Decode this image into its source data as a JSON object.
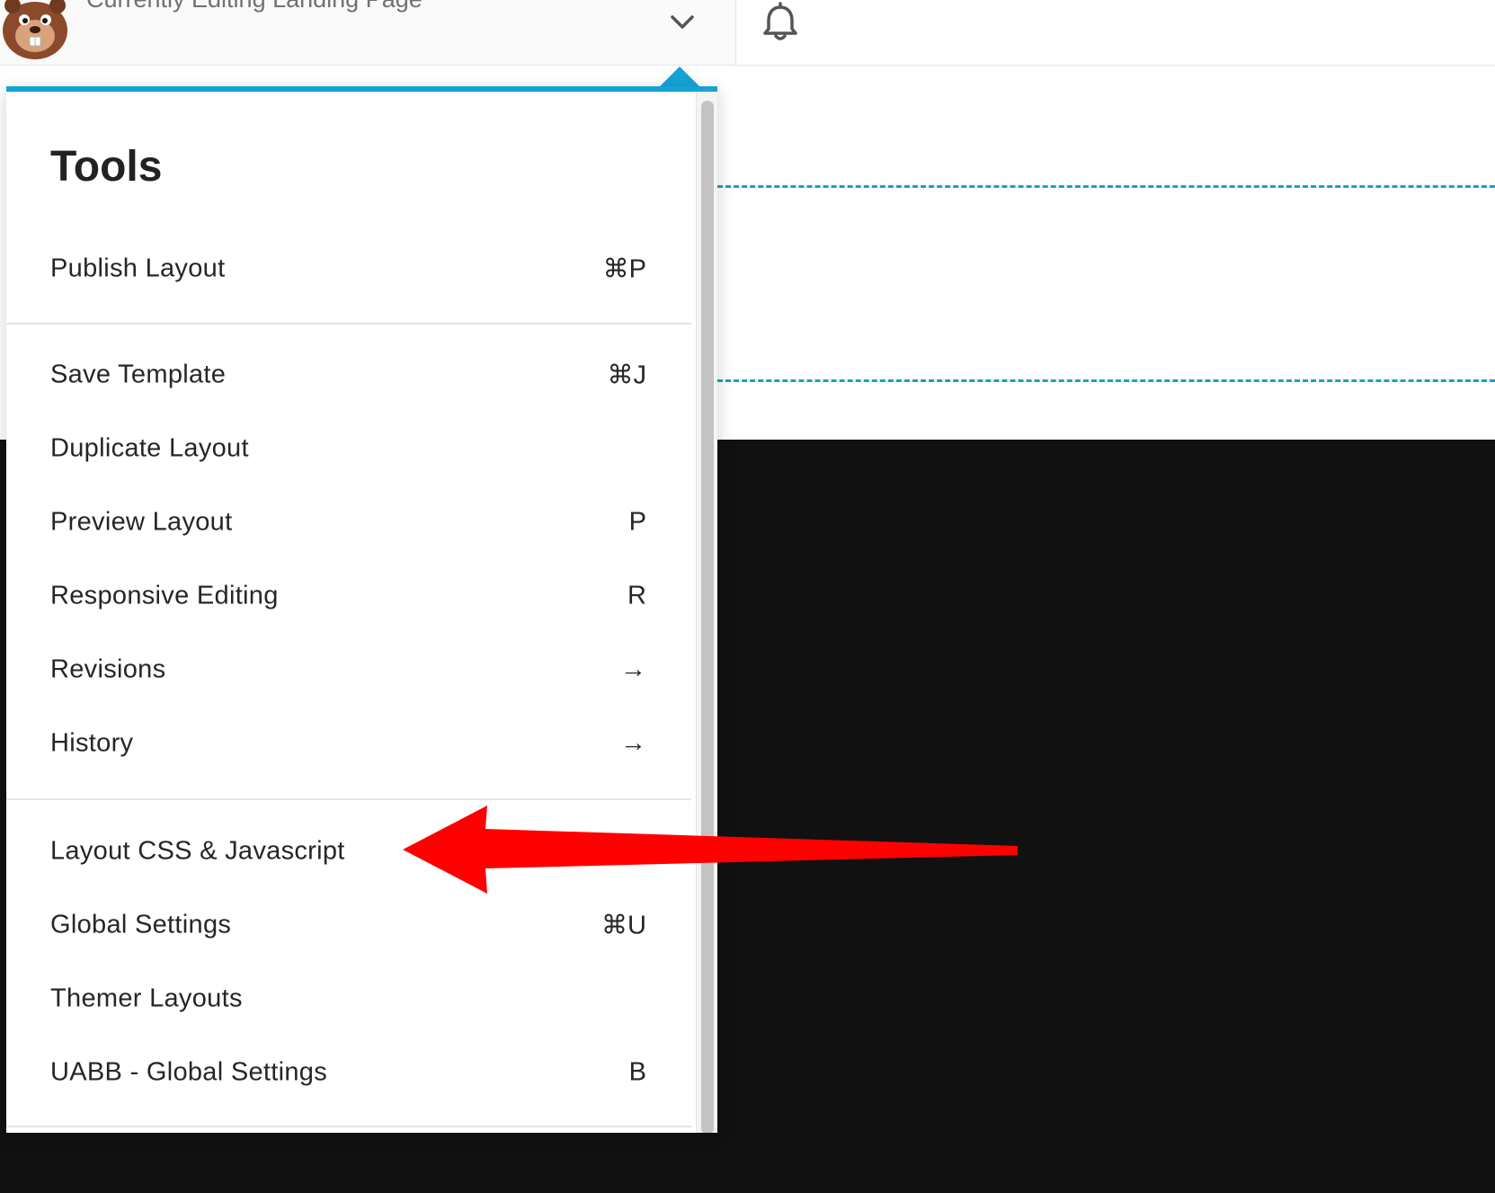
{
  "header": {
    "editing_title": "Currently Editing Landing Page",
    "logo_icon": "beaver-mascot-logo",
    "dropdown_icon": "chevron-down-icon",
    "notifications_icon": "bell-icon"
  },
  "tools_panel": {
    "title": "Tools",
    "accent_color": "#15a2d6",
    "groups": [
      {
        "items": [
          {
            "label": "Publish Layout",
            "shortcut": "⌘P"
          }
        ]
      },
      {
        "items": [
          {
            "label": "Save Template",
            "shortcut": "⌘J"
          },
          {
            "label": "Duplicate Layout",
            "shortcut": ""
          },
          {
            "label": "Preview Layout",
            "shortcut": "P"
          },
          {
            "label": "Responsive Editing",
            "shortcut": "R"
          },
          {
            "label": "Revisions",
            "shortcut": "→"
          },
          {
            "label": "History",
            "shortcut": "→"
          }
        ]
      },
      {
        "items": [
          {
            "label": "Layout CSS & Javascript",
            "shortcut": ""
          },
          {
            "label": "Global Settings",
            "shortcut": "⌘U"
          },
          {
            "label": "Themer Layouts",
            "shortcut": ""
          },
          {
            "label": "UABB - Global Settings",
            "shortcut": "B"
          }
        ]
      }
    ]
  },
  "annotation": {
    "type": "red-arrow",
    "color": "#ff0000",
    "points_to": "Layout CSS & Javascript"
  },
  "canvas": {
    "guide_color": "#1a9fc9",
    "dark_section_color": "#111111"
  }
}
